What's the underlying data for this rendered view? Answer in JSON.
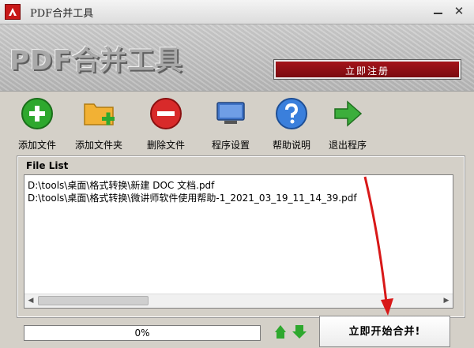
{
  "window": {
    "title": "PDF合并工具",
    "close_glyph": "✕",
    "accent_color": "#c81818"
  },
  "banner": {
    "title": "PDF合并工具",
    "register_label": "立即注册"
  },
  "toolbar": {
    "items": [
      {
        "label": "添加文件",
        "icon": "plus-circle-icon"
      },
      {
        "label": "添加文件夹",
        "icon": "folder-add-icon"
      },
      {
        "label": "删除文件",
        "icon": "minus-circle-icon"
      },
      {
        "label": "程序设置",
        "icon": "monitor-settings-icon"
      },
      {
        "label": "帮助说明",
        "icon": "help-icon"
      },
      {
        "label": "退出程序",
        "icon": "exit-arrow-icon"
      }
    ]
  },
  "file_list": {
    "label": "File List",
    "files": [
      "D:\\tools\\桌面\\格式转换\\新建 DOC 文档.pdf",
      "D:\\tools\\桌面\\格式转换\\微讲师软件使用帮助-1_2021_03_19_11_14_39.pdf"
    ],
    "scroll_left_glyph": "◀",
    "scroll_right_glyph": "▶"
  },
  "progress": {
    "value_percent": 0,
    "text": "0%"
  },
  "merge_button": {
    "label": "立即开始合并!"
  }
}
